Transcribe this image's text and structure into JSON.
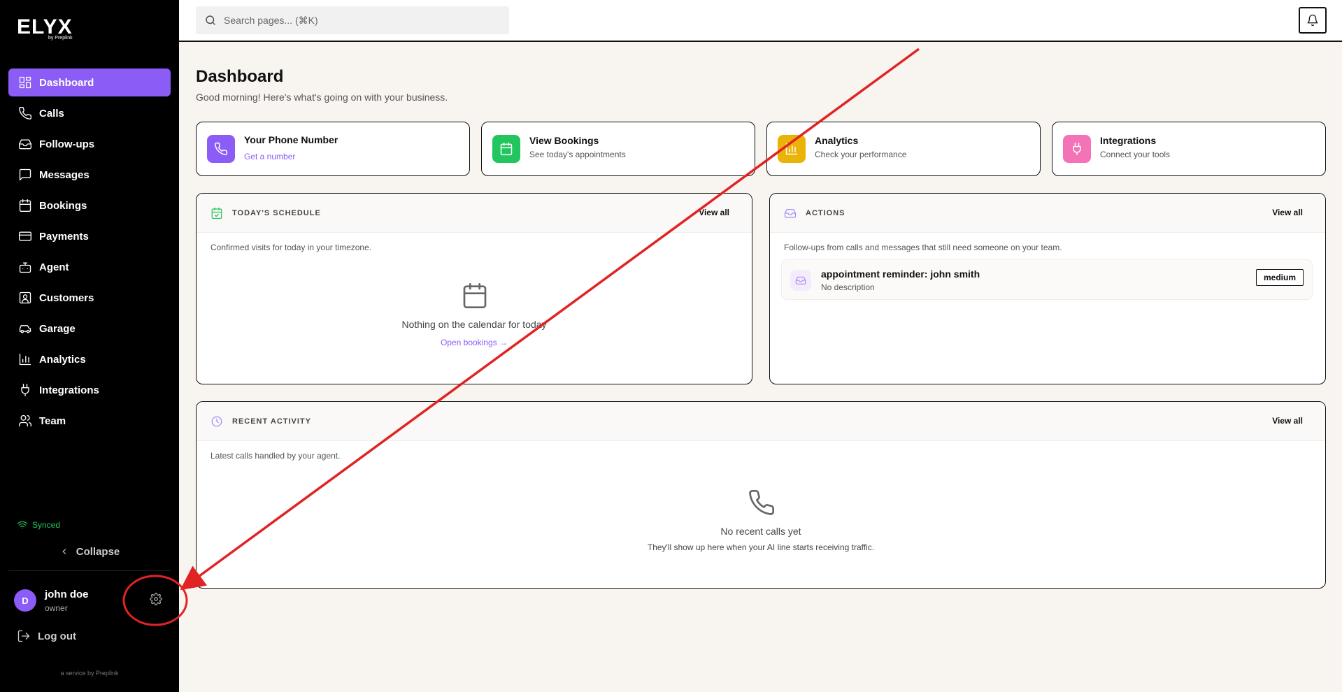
{
  "brand": {
    "logo": "ELYX",
    "byline": "by Preplink",
    "service": "a service by Preplink"
  },
  "search": {
    "placeholder": "Search pages... (⌘K)"
  },
  "sidebar": {
    "items": [
      {
        "label": "Dashboard",
        "icon": "dashboard-icon",
        "active": true
      },
      {
        "label": "Calls",
        "icon": "phone-icon"
      },
      {
        "label": "Follow-ups",
        "icon": "inbox-icon"
      },
      {
        "label": "Messages",
        "icon": "message-icon"
      },
      {
        "label": "Bookings",
        "icon": "calendar-icon"
      },
      {
        "label": "Payments",
        "icon": "credit-card-icon"
      },
      {
        "label": "Agent",
        "icon": "bot-icon"
      },
      {
        "label": "Customers",
        "icon": "contact-icon"
      },
      {
        "label": "Garage",
        "icon": "car-icon"
      },
      {
        "label": "Analytics",
        "icon": "bar-chart-icon"
      },
      {
        "label": "Integrations",
        "icon": "plug-icon"
      },
      {
        "label": "Team",
        "icon": "users-icon"
      }
    ],
    "status": "Synced",
    "collapse": "Collapse",
    "user": {
      "initial": "D",
      "name": "john doe",
      "role": "owner"
    },
    "logout": "Log out"
  },
  "header": {
    "title": "Dashboard",
    "subtitle": "Good morning! Here's what's going on with your business."
  },
  "quick_actions": [
    {
      "title": "Your Phone Number",
      "sub": "Get a number",
      "color": "#8b5cf6",
      "icon": "phone-icon"
    },
    {
      "title": "View Bookings",
      "sub": "See today's appointments",
      "color": "#22c55e",
      "icon": "calendar-icon"
    },
    {
      "title": "Analytics",
      "sub": "Check your performance",
      "color": "#eab308",
      "icon": "bar-chart-icon"
    },
    {
      "title": "Integrations",
      "sub": "Connect your tools",
      "color": "#f472b6",
      "icon": "plug-icon"
    }
  ],
  "schedule": {
    "title": "TODAY'S SCHEDULE",
    "view_all": "View all",
    "desc": "Confirmed visits for today in your timezone.",
    "empty_title": "Nothing on the calendar for today",
    "empty_link": "Open bookings →"
  },
  "actions": {
    "title": "ACTIONS",
    "view_all": "View all",
    "desc": "Follow-ups from calls and messages that still need someone on your team.",
    "items": [
      {
        "title": "appointment reminder: john smith",
        "sub": "No description",
        "priority": "medium"
      }
    ]
  },
  "activity": {
    "title": "RECENT ACTIVITY",
    "view_all": "View all",
    "desc": "Latest calls handled by your agent.",
    "empty_title": "No recent calls yet",
    "empty_sub": "They'll show up here when your AI line starts receiving traffic."
  },
  "colors": {
    "accent": "#8b5cf6",
    "annotation": "#e02424"
  }
}
